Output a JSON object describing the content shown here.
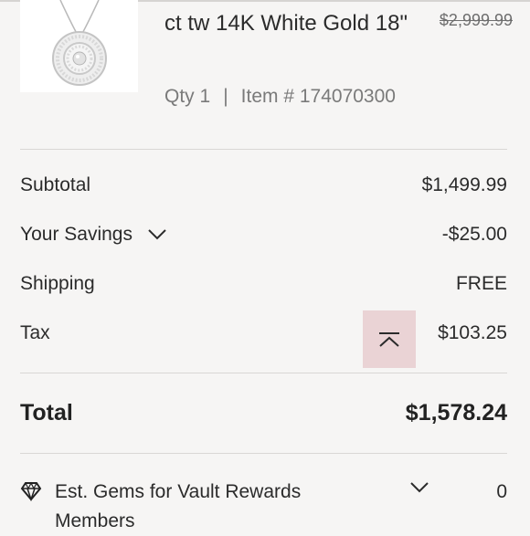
{
  "product": {
    "title": "ct tw 14K White Gold 18\"",
    "original_price": "$2,999.99",
    "qty_label": "Qty 1",
    "separator": "|",
    "item_number": "Item # 174070300"
  },
  "summary": {
    "subtotal_label": "Subtotal",
    "subtotal_value": "$1,499.99",
    "savings_label": "Your Savings",
    "savings_value": "-$25.00",
    "shipping_label": "Shipping",
    "shipping_value": "FREE",
    "tax_label": "Tax",
    "tax_value": "$103.25",
    "total_label": "Total",
    "total_value": "$1,578.24"
  },
  "rewards": {
    "label": "Est. Gems for Vault Rewards Members",
    "value": "0"
  },
  "icons": {
    "savings_toggle": "chevron-down-icon",
    "collapse": "chevron-up-icon",
    "gems": "diamond-icon",
    "gems_toggle": "chevron-down-icon"
  },
  "colors": {
    "background": "#f6f5f4",
    "highlight": "#ead3d5",
    "text": "#2b2b2b",
    "muted": "#7a7a7a"
  }
}
